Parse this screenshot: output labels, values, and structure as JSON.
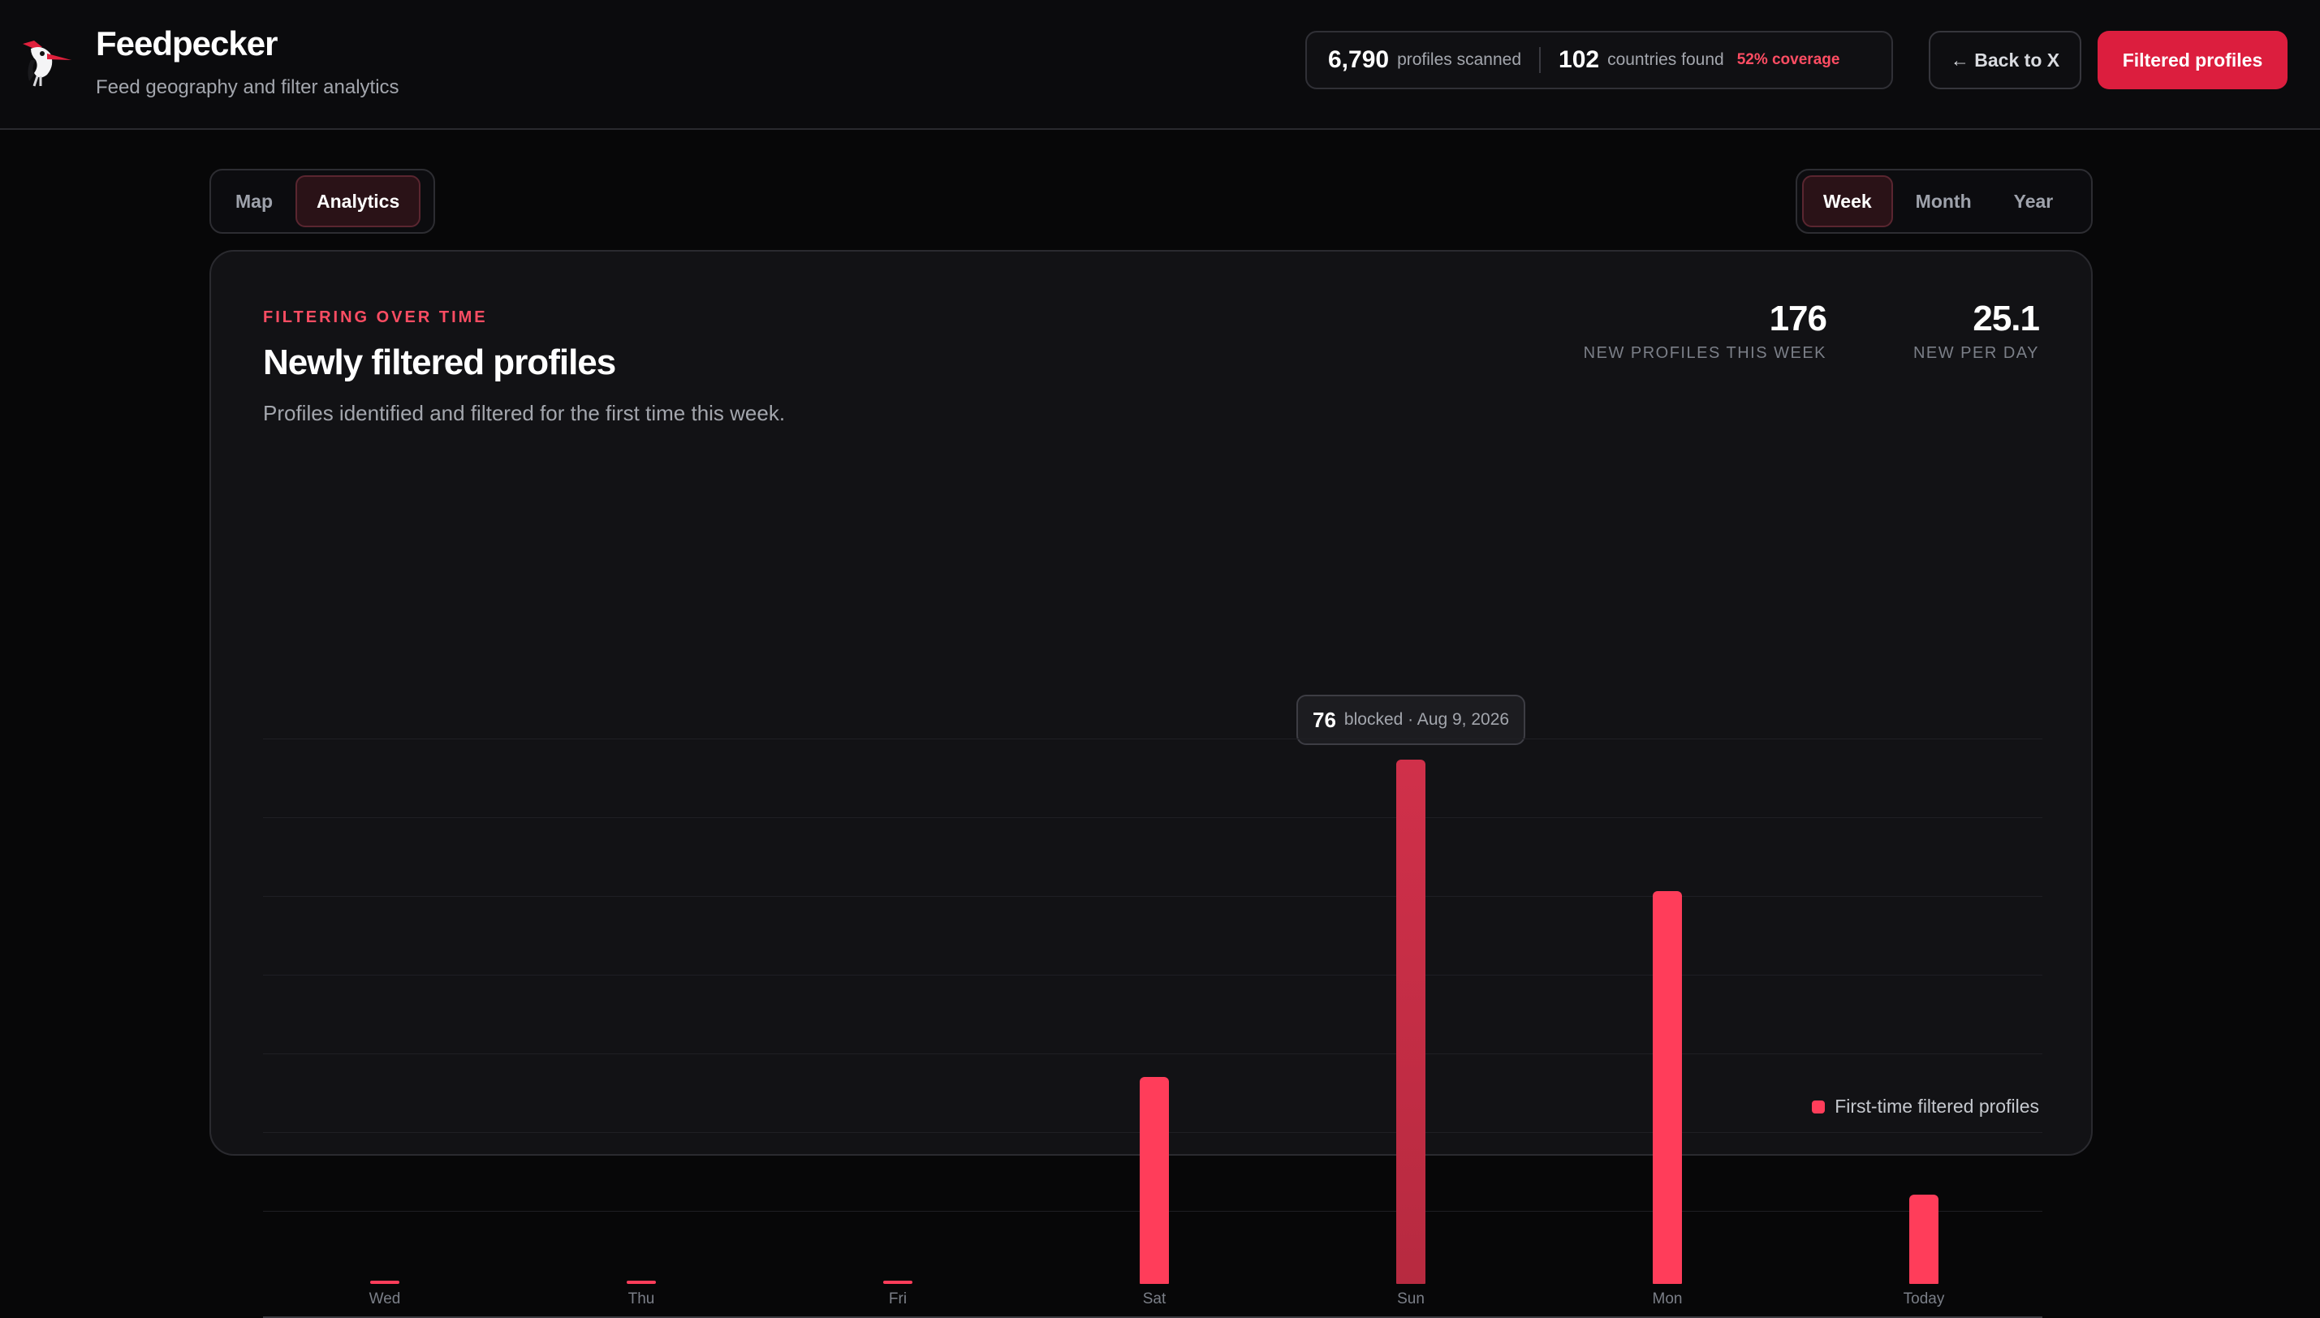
{
  "app": {
    "name": "Feedpecker",
    "subtitle": "Feed geography and filter analytics",
    "logo_icon": "woodpecker-icon"
  },
  "stats": {
    "profiles_scanned": "6,790",
    "profiles_scanned_label": "profiles scanned",
    "countries_found": "102",
    "countries_found_label": "countries found",
    "coverage": "52% coverage"
  },
  "header_buttons": {
    "back": "← Back to X",
    "filtered": "Filtered profiles"
  },
  "view_tabs": [
    {
      "label": "Map",
      "active": false
    },
    {
      "label": "Analytics",
      "active": true
    }
  ],
  "range_tabs": [
    {
      "label": "Week",
      "active": true
    },
    {
      "label": "Month",
      "active": false
    },
    {
      "label": "Year",
      "active": false
    }
  ],
  "card": {
    "eyebrow": "FILTERING OVER TIME",
    "title": "Newly filtered profiles",
    "description": "Profiles identified and filtered for the first time this week."
  },
  "kpis": {
    "week_value": "176",
    "week_label": "NEW PROFILES THIS WEEK",
    "day_value": "25.1",
    "day_label": "NEW PER DAY"
  },
  "tooltip": {
    "value": "76",
    "text": "blocked · Aug 9, 2026"
  },
  "colors": {
    "accent": "#ff3d5a",
    "brand_button": "#dc1e3e",
    "coverage": "#ff4d63",
    "highlighted_bar": "#c42e45"
  },
  "chart_data": {
    "type": "bar",
    "categories": [
      "Wed",
      "Thu",
      "Fri",
      "Sat",
      "Sun",
      "Mon",
      "Today"
    ],
    "series": [
      {
        "name": "First-time filtered profiles",
        "values": [
          0,
          0,
          0,
          30,
          76,
          57,
          13
        ]
      }
    ],
    "highlighted_index": 4,
    "ylim": [
      0,
      76
    ],
    "gridlines": 7,
    "grid": true,
    "legend": "bottom-right"
  }
}
